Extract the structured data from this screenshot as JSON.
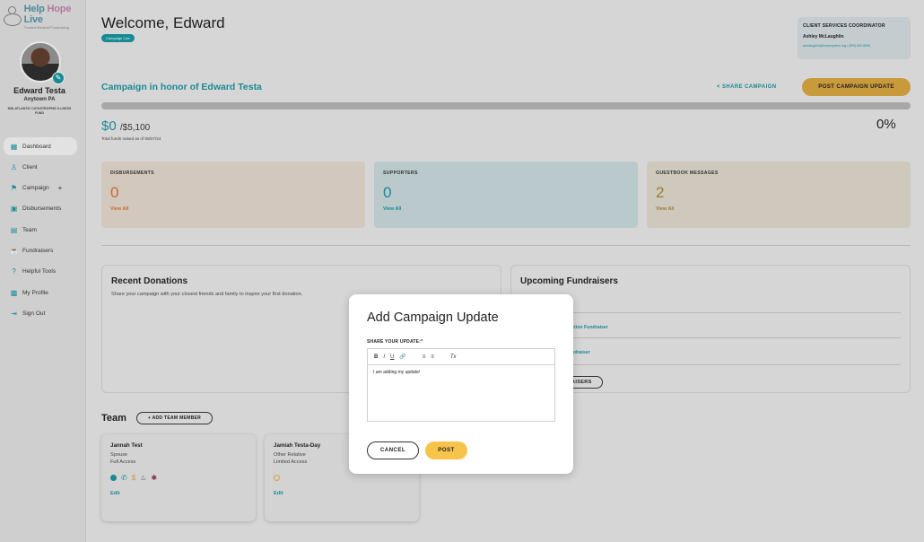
{
  "brand": {
    "name_left": "Help",
    "name_mid": "Hope",
    "name_right": "Live",
    "tagline": "Trusted Medical Fundraising"
  },
  "user": {
    "name": "Edward Testa",
    "location": "Anytown PA",
    "fund": "MID-ATLANTIC CATASTROPHIC ILLNESS FUND"
  },
  "nav": [
    {
      "label": "Dashboard",
      "icon": "dashboard-icon"
    },
    {
      "label": "Client",
      "icon": "client-icon"
    },
    {
      "label": "Campaign",
      "icon": "campaign-icon"
    },
    {
      "label": "Disbursements",
      "icon": "disbursements-icon"
    },
    {
      "label": "Team",
      "icon": "team-icon"
    },
    {
      "label": "Fundraisers",
      "icon": "fundraisers-icon"
    },
    {
      "label": "Helpful Tools",
      "icon": "help-icon"
    },
    {
      "label": "My Profile",
      "icon": "profile-icon"
    },
    {
      "label": "Sign Out",
      "icon": "sign-out-icon"
    }
  ],
  "header": {
    "welcome": "Welcome, Edward",
    "badge": "Campaign Live"
  },
  "coordinator": {
    "title": "CLIENT SERVICES COORDINATOR",
    "name": "Ashley McLaughlin",
    "contact": "amclaughlin@helphopelive.org • (800) 642-8399"
  },
  "campaign": {
    "title": "Campaign in honor of Edward Testa",
    "share_label": "SHARE CAMPAIGN",
    "post_label": "POST CAMPAIGN UPDATE",
    "raised": "$0",
    "goal": "/$5,100",
    "percent": "0%",
    "progress": 0,
    "note": "Total funds raised as of 08/27/24"
  },
  "stats": [
    {
      "title": "DISBURSEMENTS",
      "value": "0",
      "link": "View All"
    },
    {
      "title": "SUPPORTERS",
      "value": "0",
      "link": "View All"
    },
    {
      "title": "GUESTBOOK MESSAGES",
      "value": "2",
      "link": "View All"
    }
  ],
  "recent": {
    "title": "Recent Donations",
    "sub": "Share your campaign with your closest friends and family to inspire your first donation."
  },
  "upcoming": {
    "title": "Upcoming Fundraisers",
    "rows": [
      "uction Fundraiser",
      "undraiser"
    ],
    "button": "AISERS"
  },
  "team": {
    "title": "Team",
    "add_label": "+ ADD TEAM MEMBER",
    "members": [
      {
        "name": "Jannah Test",
        "relation": "Spouse",
        "access": "Full Access",
        "edit": "Edit"
      },
      {
        "name": "Jamiah Testa-Day",
        "relation": "Other Relative",
        "access": "Limited Access",
        "edit": "Edit"
      }
    ]
  },
  "modal": {
    "title": "Add Campaign Update",
    "label": "SHARE YOUR UPDATE:*",
    "toolbar": [
      "B",
      "I",
      "U",
      "🔗",
      "≡",
      "≡",
      "Tx"
    ],
    "content": "I am adding my update!",
    "cancel": "CANCEL",
    "post": "POST"
  },
  "colors": {
    "teal": "#178a93",
    "gold": "#f7c34a",
    "orange": "#c26d32"
  }
}
